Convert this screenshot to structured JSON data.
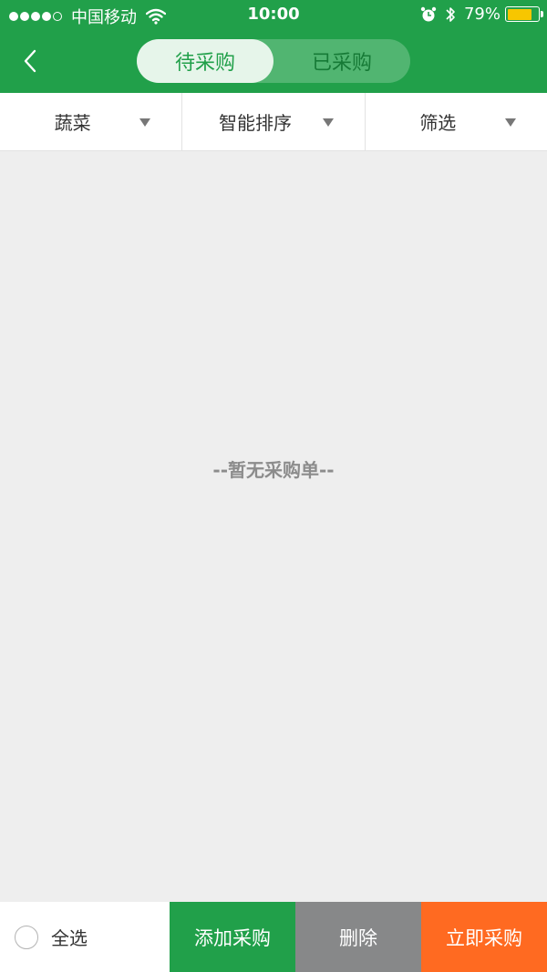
{
  "status_bar": {
    "carrier": "中国移动",
    "time": "10:00",
    "battery_percent": "79%",
    "battery_level": 0.79
  },
  "header": {
    "tabs": [
      {
        "label": "待采购",
        "active": true
      },
      {
        "label": "已采购",
        "active": false
      }
    ],
    "back_icon": "chevron-left-icon"
  },
  "filters": [
    {
      "label": "蔬菜",
      "icon": "caret-down-icon"
    },
    {
      "label": "智能排序",
      "icon": "caret-down-icon"
    },
    {
      "label": "筛选",
      "icon": "caret-down-icon"
    }
  ],
  "empty_message": "--暂无采购单--",
  "bottom_bar": {
    "select_all_label": "全选",
    "add_label": "添加采购",
    "delete_label": "删除",
    "buy_label": "立即采购"
  },
  "colors": {
    "brand_green": "#21a04a",
    "delete_gray": "#878889",
    "buy_orange": "#ff6a21",
    "battery_yellow": "#f7c600"
  }
}
